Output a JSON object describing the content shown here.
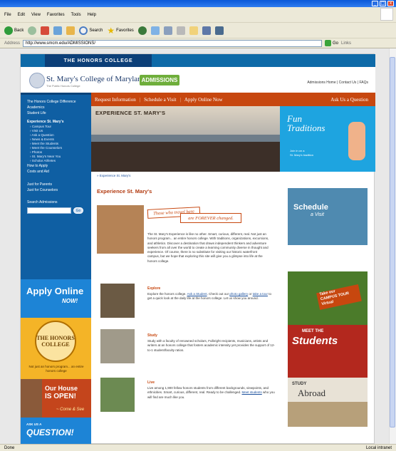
{
  "browser": {
    "menu": [
      "File",
      "Edit",
      "View",
      "Favorites",
      "Tools",
      "Help"
    ],
    "toolbar": {
      "back": "Back",
      "search": "Search",
      "favorites": "Favorites"
    },
    "address_label": "Address",
    "address_url": "http://www.smcm.edu/ADMISSIONS/",
    "go": "Go",
    "links": "Links",
    "status_left": "Done",
    "status_right": "Local intranet",
    "win_min": "_",
    "win_max": "□",
    "win_close": "x"
  },
  "site": {
    "honors_banner": "THE HONORS COLLEGE",
    "college_name": "St. Mary's College of Maryland",
    "college_tag": "The Public Honors College",
    "admissions_badge": "ADMISSIONS",
    "top_links": "Admissions Home | Contact Us | FAQs"
  },
  "nav": {
    "items": [
      "The Honors College Difference",
      "Academics",
      "Student Life",
      "Experience St. Mary's"
    ],
    "subitems": [
      "› Campus Tour",
      "› Visit Us",
      "› Ask a Question",
      "› News & Events",
      "› Meet the Students",
      "› Meet the Counselors",
      "› Photos",
      "› St. Mary's Near You",
      "› Scholar Athletes"
    ],
    "items2": [
      "How to Apply",
      "Costs and Aid"
    ],
    "items3": [
      "Just for Parents",
      "Just for Counselors"
    ],
    "search_title": "Search Admissions",
    "search_go": "Go"
  },
  "sidebar_promos": {
    "apply_line1": "Apply Online",
    "apply_line2": "NOW!",
    "honors_seal": "THE HONORS COLLEGE",
    "honors_caption": "Not just an honors program... an entire honors college",
    "house_line1": "Our House",
    "house_line2": "IS OPEN!",
    "house_sub": "~ Come & See",
    "question_small": "ASK US A",
    "question_big": "QUESTION!"
  },
  "orange_bar": {
    "links": [
      "Request Information",
      "Schedule a Visit",
      "Apply Online Now"
    ],
    "separator": "|",
    "right": "Ask Us a Question"
  },
  "hero": {
    "title": "EXPERIENCE ST. MARY'S",
    "fun_line1": "Fun",
    "fun_line2": "Traditions",
    "fun_sub_line1": "Join in on a",
    "fun_sub_line2": "St. Mary's tradition"
  },
  "content": {
    "breadcrumb": "» Experience St. Mary's",
    "title": "Experience St. Mary's",
    "tagline1": "Those who travel here",
    "tagline2": "are FOREVER changed.",
    "intro": "The St. Mary's Experience is like no other. Smart, curious, different, real. Not just an honors program... an entire honors college. With traditions, organizations, excursions, and athletics. Discover a destination that draws independent thinkers and adventure seekers from all over the world to create a learning community diverse in thought and experience. Of course, there is no substitute for visiting our historic waterfront campus, but we hope that exploring this site will give you a glimpse into life at the honors college.",
    "explore_title": "Explore",
    "explore_pre": "Explore the honors college.",
    "explore_link1": "Ask a Student",
    "explore_mid": ". Check out our",
    "explore_link2": "photo gallery",
    "explore_or": "or",
    "explore_link3": "take a tour",
    "explore_post": "to get a quick look at the daily life at the honors college. Let us show you around.",
    "study_title": "Study",
    "study_text": "Study with a faculty of renowned scholars, Fulbright recipients, musicians, artists and writers at an honors college that fosters academic intensity yet provides the support of 12-to-1 student/faculty ratios.",
    "live_title": "Live",
    "live_pre": "Live among 1,900 fellow honors students from different backgrounds, viewpoints, and ethnicities. Smart, curious, different, real. Ready to be challenged.",
    "live_link": "Meet students",
    "live_post": "who you will find are much like you."
  },
  "right_promos": {
    "schedule_line1": "Schedule",
    "schedule_line2": "a Visit",
    "campus_line1": "Take our",
    "campus_line2": "CAMPUS TOUR",
    "campus_line3": "Virtual",
    "students_meet": "MEET THE",
    "students_big": "Students",
    "abroad_small": "STUDY",
    "abroad_big": "Abroad"
  }
}
